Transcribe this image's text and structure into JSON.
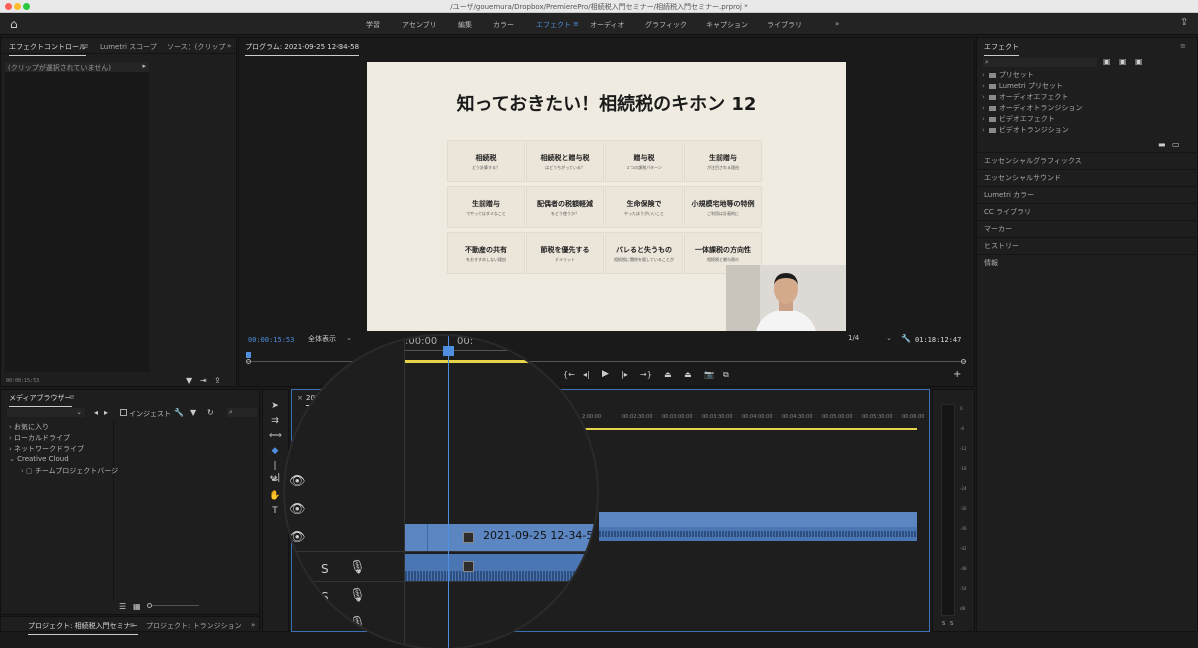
{
  "window": {
    "title": "/ユーザ/gouemura/Dropbox/PremierePro/相続税入門セミナー/相続税入門セミナー.prproj *"
  },
  "nav": {
    "items": [
      "学習",
      "アセンブリ",
      "編集",
      "カラー",
      "エフェクト",
      "オーディオ",
      "グラフィック",
      "キャプション",
      "ライブラリ"
    ],
    "active": "エフェクト",
    "more": "»"
  },
  "effect_controls": {
    "tabs": [
      "エフェクトコントロール",
      "Lumetri スコープ",
      "ソース：(クリップ"
    ],
    "empty_text": "(クリップが選択されていません)",
    "timecode": "00:00:15:53"
  },
  "program": {
    "title": "プログラム: 2021-09-25 12-34-58",
    "current_time": "00:00:15:53",
    "fit": "全体表示",
    "resolution": "1/4",
    "duration": "01:18:12:47",
    "scale_labels": [
      ":00:00",
      "00:"
    ]
  },
  "slide": {
    "title": "知っておきたい！相続税のキホン 12",
    "cells": [
      {
        "main": "相続税",
        "sub": "どう計算する？"
      },
      {
        "main": "相続税と贈与税",
        "sub": "はどうちがっている？"
      },
      {
        "main": "贈与税",
        "sub": "２つの課税パターン"
      },
      {
        "main": "生前贈与",
        "sub": "が注目される理由"
      },
      {
        "main": "生前贈与",
        "sub": "でやってはダメなこと"
      },
      {
        "main": "配偶者の税額軽減",
        "sub": "をどう使うか？"
      },
      {
        "main": "生命保険で",
        "sub": "やったほうがいいこと"
      },
      {
        "main": "小規模宅地等の特例",
        "sub": "ご利用は計画的に"
      },
      {
        "main": "不動産の共有",
        "sub": "をおすすめしない理由"
      },
      {
        "main": "節税を優先する",
        "sub": "デメリット"
      },
      {
        "main": "バレると失うもの",
        "sub": "相続税に関係を隠していることが"
      },
      {
        "main": "一体課税の方向性",
        "sub": "相続税と贈与税の"
      }
    ]
  },
  "media_browser": {
    "title": "メディアブラウザー",
    "ingest": "インジェスト",
    "items": [
      "お気に入り",
      "ローカルドライブ",
      "ネットワークドライブ",
      "Creative Cloud",
      "チームプロジェクトバージ"
    ]
  },
  "project_tabs": [
    "プロジェクト: 相続税入門セミナー",
    "プロジェクト: トランジション"
  ],
  "timeline": {
    "tab": "2021",
    "ruler": [
      "2:00:00",
      "00:02:30:00",
      "00:03:00:00",
      "00:03:30:00",
      "00:04:00:00",
      "00:04:30:00",
      "00:05:00:00",
      "00:05:30:00",
      "00:06:00"
    ],
    "clip_name": "2021-09-25 12-34-58.m",
    "solo": "S",
    "playhead_pct": 0.12
  },
  "effects_panel": {
    "title": "エフェクト",
    "tree": [
      "プリセット",
      "Lumetri プリセット",
      "オーディオエフェクト",
      "オーディオトランジション",
      "ビデオエフェクト",
      "ビデオトランジション"
    ],
    "sections": [
      "エッセンシャルグラフィックス",
      "エッセンシャルサウンド",
      "Lumetri カラー",
      "CC ライブラリ",
      "マーカー",
      "ヒストリー",
      "情報"
    ]
  },
  "audio_meter": {
    "labels": [
      "0",
      "-6",
      "-12",
      "-18",
      "-24",
      "-30",
      "-36",
      "-42",
      "-48",
      "-54",
      "dB"
    ],
    "solo": [
      "S",
      "S"
    ]
  },
  "colors": {
    "accent": "#4e8fe0",
    "clip": "#5b86c2",
    "playhead": "#4e8fe0",
    "workarea": "#e6d34a"
  }
}
